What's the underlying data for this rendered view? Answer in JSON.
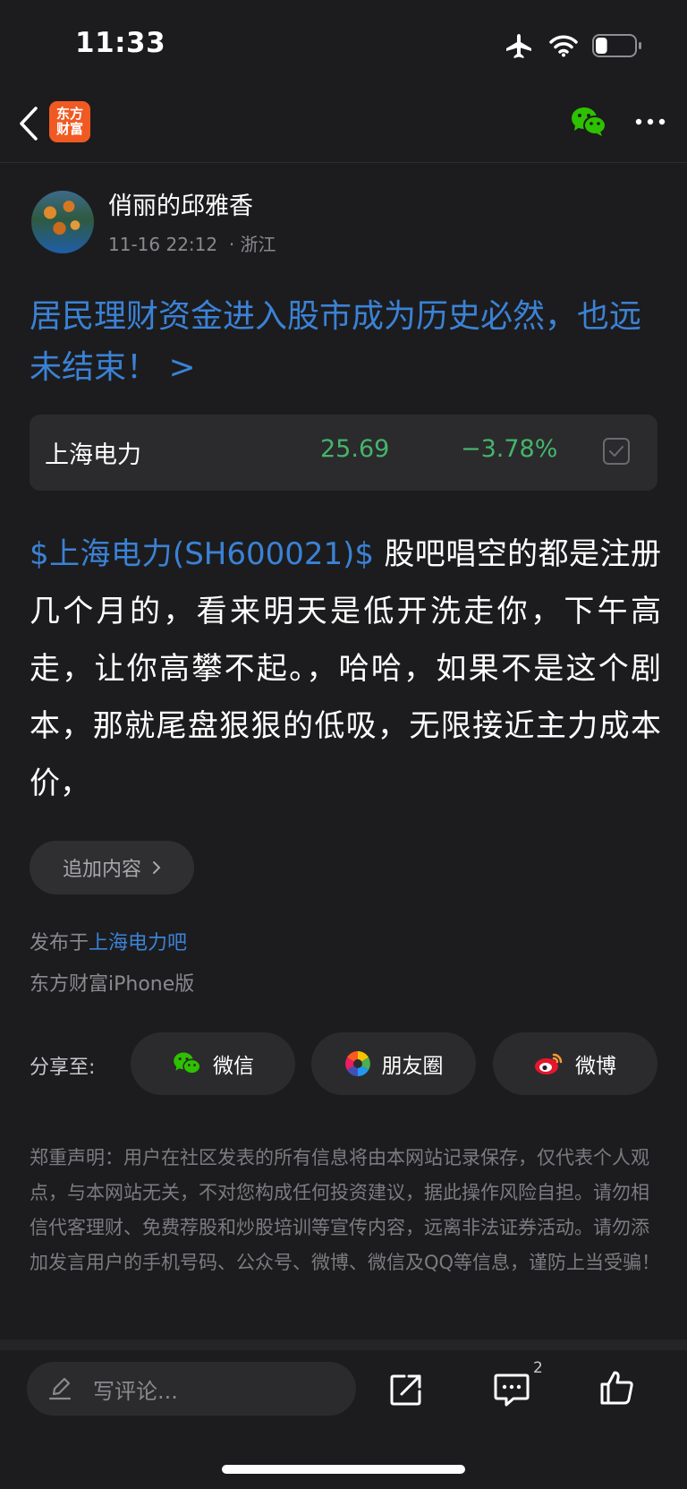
{
  "status_bar": {
    "time": "11:33",
    "battery_level": 0.3
  },
  "nav": {
    "logo_line1": "东方",
    "logo_line2": "财富",
    "brand_color": "#f05a22"
  },
  "author": {
    "name": "俏丽的邱雅香",
    "time": "11-16 22:12",
    "location": "· 浙江"
  },
  "post": {
    "title": "居民理财资金进入股市成为历史必然，也远未结束！ >",
    "stock": {
      "name": "上海电力",
      "price": "25.69",
      "change": "−3.78%"
    },
    "tag": "$上海电力(SH600021)$",
    "body": " 股吧唱空的都是注册几个月的，看来明天是低开洗走你，下午高走，让你高攀不起。，哈哈，如果不是这个剧本，那就尾盘狠狠的低吸，无限接近主力成本价，"
  },
  "append_label": "追加内容",
  "published": {
    "prefix": "发布于",
    "bar": "上海电力吧"
  },
  "client": "东方财富iPhone版",
  "share": {
    "label": "分享至:",
    "wechat": "微信",
    "moments": "朋友圈",
    "weibo": "微博"
  },
  "disclaimer": "郑重声明：用户在社区发表的所有信息将由本网站记录保存，仅代表个人观点，与本网站无关，不对您构成任何投资建议，据此操作风险自担。请勿相信代客理财、免费荐股和炒股培训等宣传内容，远离非法证券活动。请勿添加发言用户的手机号码、公众号、微博、微信及QQ等信息，谨防上当受骗！",
  "bottom": {
    "comment_placeholder": "写评论...",
    "comment_count": "2"
  },
  "colors": {
    "link": "#3b82d6",
    "down_green": "#45b56a",
    "background": "#1c1c1e"
  }
}
